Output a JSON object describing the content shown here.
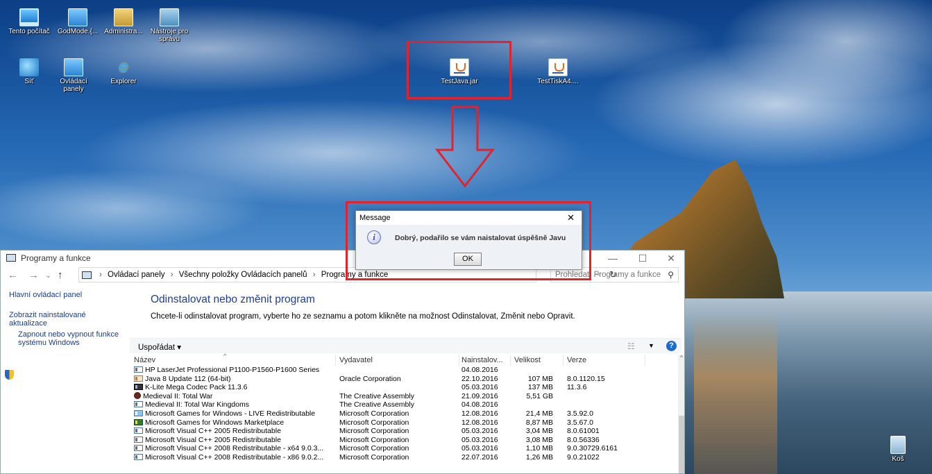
{
  "desktop": {
    "icons_row1": [
      {
        "label": "Tento počítač",
        "icon": "computer-icon"
      },
      {
        "label": "GodMode.{...",
        "icon": "control-panel-icon"
      },
      {
        "label": "Administra...",
        "icon": "admin-user-icon"
      },
      {
        "label": "Nástroje pro správu",
        "icon": "admin-tools-icon"
      }
    ],
    "icons_row2": [
      {
        "label": "Síť",
        "icon": "network-icon"
      },
      {
        "label": "Ovládací panely",
        "icon": "control-panel-icon"
      },
      {
        "label": "Explorer",
        "icon": "internet-explorer-icon"
      }
    ],
    "jar_files": [
      {
        "label": "TestJava.jar",
        "icon": "java-icon"
      },
      {
        "label": "TestTiskA4....",
        "icon": "java-icon"
      }
    ],
    "recycle_bin": {
      "label": "Koš",
      "icon": "recycle-bin-icon"
    }
  },
  "window": {
    "title": "Programy a funkce",
    "controls": {
      "minimize": "—",
      "maximize": "☐",
      "close": "✕"
    },
    "nav": {
      "back": "←",
      "forward": "→",
      "dropdown": "⌄",
      "up": "↑"
    },
    "breadcrumbs": [
      "Ovládací panely",
      "Všechny položky Ovládacích panelů",
      "Programy a funkce"
    ],
    "search_placeholder": "Prohledat: Programy a funkce",
    "sidebar": {
      "home": "Hlavní ovládací panel",
      "updates": "Zobrazit nainstalované aktualizace",
      "features": "Zapnout nebo vypnout funkce systému Windows"
    },
    "heading": "Odinstalovat nebo změnit program",
    "description": "Chcete-li odinstalovat program, vyberte ho ze seznamu a potom klikněte na možnost Odinstalovat, Změnit nebo Opravit.",
    "toolbar": {
      "organize": "Uspořádat ▾",
      "help": "?"
    },
    "columns": {
      "name": "Název",
      "publisher": "Vydavatel",
      "installed": "Nainstalov...",
      "size": "Velikost",
      "version": "Verze"
    },
    "programs": [
      {
        "name": "HP LaserJet Professional P1100-P1560-P1600 Series",
        "publisher": "",
        "installed": "04.08.2016",
        "size": "",
        "version": "",
        "icon": "generic"
      },
      {
        "name": "Java 8 Update 112 (64-bit)",
        "publisher": "Oracle Corporation",
        "installed": "22.10.2016",
        "size": "107 MB",
        "version": "8.0.1120.15",
        "icon": "java"
      },
      {
        "name": "K-Lite Mega Codec Pack 11.3.6",
        "publisher": "",
        "installed": "05.03.2016",
        "size": "137 MB",
        "version": "11.3.6",
        "icon": "klite"
      },
      {
        "name": "Medieval II: Total War",
        "publisher": "The Creative Assembly",
        "installed": "21.09.2016",
        "size": "5,51 GB",
        "version": "",
        "icon": "mtw"
      },
      {
        "name": "Medieval II: Total War Kingdoms",
        "publisher": "The Creative Assembly",
        "installed": "04.08.2016",
        "size": "",
        "version": "",
        "icon": "generic"
      },
      {
        "name": "Microsoft Games for Windows - LIVE Redistributable",
        "publisher": "Microsoft Corporation",
        "installed": "12.08.2016",
        "size": "21,4 MB",
        "version": "3.5.92.0",
        "icon": "live"
      },
      {
        "name": "Microsoft Games for Windows Marketplace",
        "publisher": "Microsoft Corporation",
        "installed": "12.08.2016",
        "size": "8,87 MB",
        "version": "3.5.67.0",
        "icon": "market"
      },
      {
        "name": "Microsoft Visual C++ 2005 Redistributable",
        "publisher": "Microsoft Corporation",
        "installed": "05.03.2016",
        "size": "3,04 MB",
        "version": "8.0.61001",
        "icon": "generic"
      },
      {
        "name": "Microsoft Visual C++ 2005 Redistributable",
        "publisher": "Microsoft Corporation",
        "installed": "05.03.2016",
        "size": "3,08 MB",
        "version": "8.0.56336",
        "icon": "generic"
      },
      {
        "name": "Microsoft Visual C++ 2008 Redistributable - x64 9.0.3...",
        "publisher": "Microsoft Corporation",
        "installed": "05.03.2016",
        "size": "1,10 MB",
        "version": "9.0.30729.6161",
        "icon": "generic"
      },
      {
        "name": "Microsoft Visual C++ 2008 Redistributable - x86 9.0.2...",
        "publisher": "Microsoft Corporation",
        "installed": "22.07.2016",
        "size": "1,26 MB",
        "version": "9.0.21022",
        "icon": "generic"
      }
    ]
  },
  "dialog": {
    "title": "Message",
    "close": "✕",
    "message": "Dobrý, podařilo se vám naistalovat úspěšně Javu",
    "info_glyph": "i",
    "ok_label": "OK"
  },
  "annotation_color": "#e0232d"
}
